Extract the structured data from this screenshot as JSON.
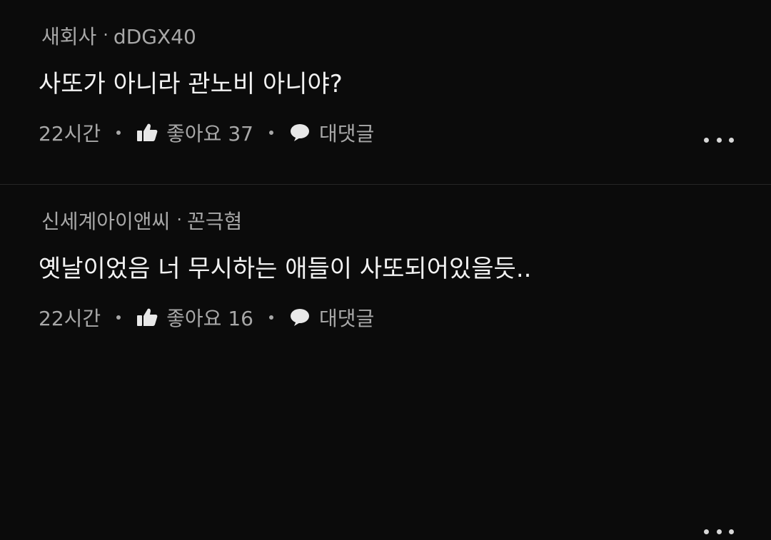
{
  "comments": [
    {
      "author_group": "새회사",
      "author_name": "dDGX40",
      "separator": "·",
      "text": "사또가 아니라 관노비 아니야?",
      "time": "22시간",
      "likes_label": "좋아요 37",
      "reply_label": "대댓글"
    },
    {
      "author_group": "신세계아이앤씨",
      "author_name": "꼰극혐",
      "separator": "·",
      "text": "옛날이었음 너 무시하는 애들이 사또되어있을듯..",
      "time": "22시간",
      "likes_label": "좋아요 16",
      "reply_label": "대댓글"
    }
  ],
  "icons": {
    "like": "thumbs-up-icon",
    "reply": "speech-bubble-icon",
    "more": "more-horizontal-icon"
  }
}
